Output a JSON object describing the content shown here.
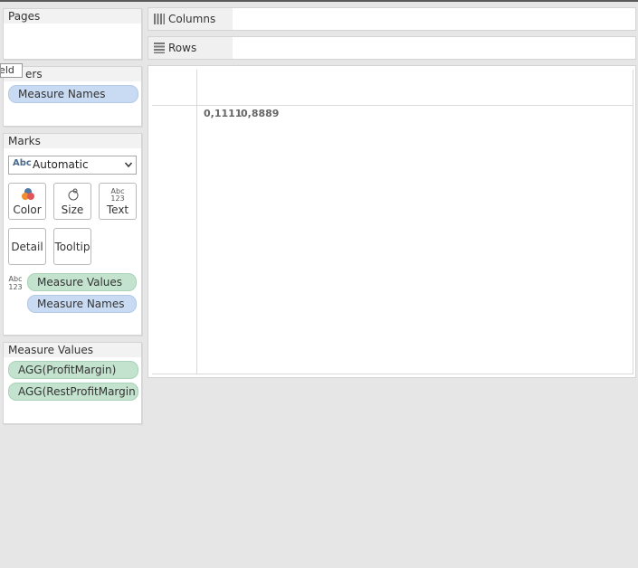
{
  "pages": {
    "title": "Pages"
  },
  "filters": {
    "title": "ers",
    "tooltip_fragment": "ield",
    "pill": "Measure Names"
  },
  "marks": {
    "title": "Marks",
    "mark_type": {
      "icon": "Abc",
      "value": "Automatic"
    },
    "buttons": [
      {
        "label": "Color",
        "icon": "color-icon"
      },
      {
        "label": "Size",
        "icon": "size-icon"
      },
      {
        "label": "Text",
        "icon": "text-icon"
      },
      {
        "label": "Detail"
      },
      {
        "label": "Tooltip"
      }
    ],
    "fields": [
      {
        "label": "Measure Values",
        "kind": "measure"
      },
      {
        "label": "Measure Names",
        "kind": "dimension"
      }
    ],
    "text_icon": {
      "top": "Abc",
      "bottom": "123"
    }
  },
  "measure_values": {
    "title": "Measure Values",
    "items": [
      "AGG(ProfitMargin)",
      "AGG(RestProfitMargin)"
    ]
  },
  "shelves": {
    "columns": "Columns",
    "rows": "Rows"
  },
  "view": {
    "cells": [
      "0,1111",
      "0,8889"
    ]
  },
  "colors": {
    "dimension_pill": "#c9dbf2",
    "measure_pill": "#c3e3cf",
    "background": "#e6e6e6"
  }
}
